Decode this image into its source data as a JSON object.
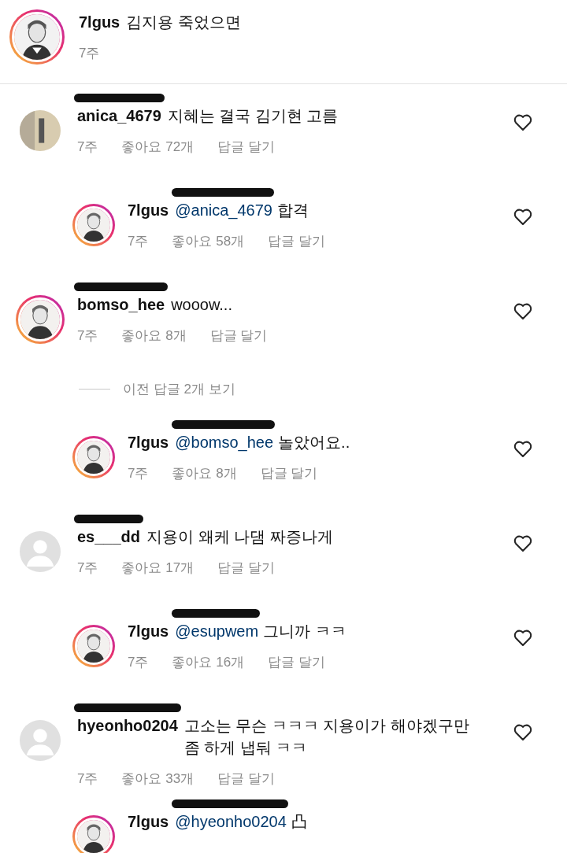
{
  "post": {
    "username": "7lgus",
    "text": "김지용 죽었으면",
    "time": "7주",
    "default_avatar": false,
    "ring": true
  },
  "comments": [
    {
      "kind": "comment",
      "default_avatar": false,
      "ring": false,
      "username": "anica_4679",
      "redacted": true,
      "text": "지혜는 결국 김기현 고름",
      "time": "7주",
      "likes": "좋아요 72개",
      "reply": "답글 달기"
    },
    {
      "kind": "reply",
      "default_avatar": false,
      "ring": true,
      "username": "7lgus",
      "mention": "@anica_4679",
      "mention_redacted": true,
      "text": "합격",
      "time": "7주",
      "likes": "좋아요 58개",
      "reply": "답글 달기"
    },
    {
      "kind": "comment",
      "default_avatar": false,
      "ring": true,
      "username": "bomso_hee",
      "redacted": true,
      "text": "wooow...",
      "time": "7주",
      "likes": "좋아요 8개",
      "reply": "답글 달기"
    },
    {
      "kind": "more",
      "label": "이전 답글 2개 보기"
    },
    {
      "kind": "reply",
      "default_avatar": false,
      "ring": true,
      "username": "7lgus",
      "mention": "@bomso_hee",
      "mention_redacted": true,
      "text": "놀았어요..",
      "time": "7주",
      "likes": "좋아요 8개",
      "reply": "답글 달기"
    },
    {
      "kind": "comment",
      "default_avatar": true,
      "ring": false,
      "username": "es___dd",
      "redacted": true,
      "text": "지용이 왜케 나댐 짜증나게",
      "time": "7주",
      "likes": "좋아요 17개",
      "reply": "답글 달기"
    },
    {
      "kind": "reply",
      "default_avatar": false,
      "ring": true,
      "username": "7lgus",
      "mention": "@esupwem",
      "mention_redacted": true,
      "text": "그니까 ㅋㅋ",
      "time": "7주",
      "likes": "좋아요 16개",
      "reply": "답글 달기"
    },
    {
      "kind": "comment",
      "default_avatar": true,
      "ring": false,
      "username": "hyeonho0204",
      "redacted": true,
      "text": "고소는 무슨 ㅋㅋㅋ 지용이가 해야겠구만 좀 하게 냅둬 ㅋㅋ",
      "time": "7주",
      "likes": "좋아요 33개",
      "reply": "답글 달기"
    },
    {
      "kind": "reply",
      "default_avatar": false,
      "ring": true,
      "username": "7lgus",
      "mention": "@hyeonho0204",
      "mention_redacted": true,
      "text": "凸"
    }
  ]
}
